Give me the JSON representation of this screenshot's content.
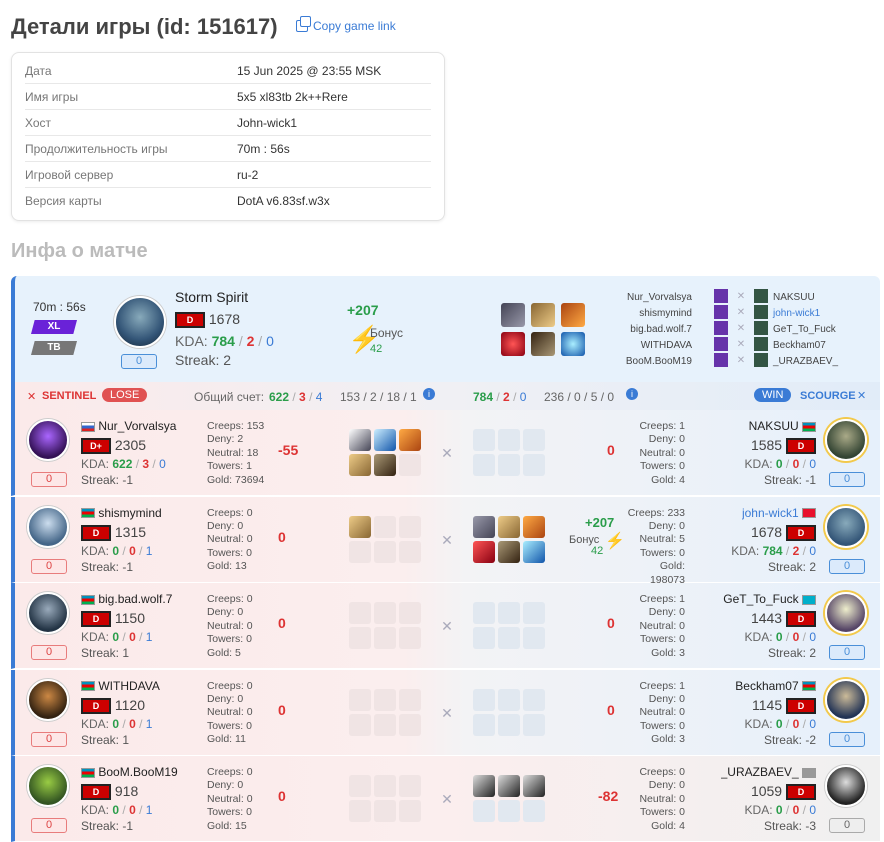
{
  "page": {
    "title": "Детали игры (id: 151617)",
    "copy_link": "Copy game link",
    "section2": "Инфа о матче"
  },
  "info": [
    {
      "k": "Дата",
      "v": "15 Jun 2025 @ 23:55 MSK"
    },
    {
      "k": "Имя игры",
      "v": "5x5 xl83tb 2k++Rere"
    },
    {
      "k": "Хост",
      "v": "John-wick1"
    },
    {
      "k": "Продолжительность игры",
      "v": "70m : 56s"
    },
    {
      "k": "Игровой сервер",
      "v": "ru-2"
    },
    {
      "k": "Версия карты",
      "v": "DotA v6.83sf.w3x"
    }
  ],
  "summary": {
    "duration": "70m : 56s",
    "tag1": "XL",
    "tag2": "TB",
    "hero": "Storm Spirit",
    "badge": "D",
    "rating": "1678",
    "kda_label": "KDA:",
    "k": "784",
    "d": "2",
    "a": "0",
    "streak": "Streak: 2",
    "count": "0",
    "delta": "+207",
    "bonus_label": "Бонус",
    "bonus": "42",
    "left_players": [
      "Nur_Vorvalsya",
      "shismymind",
      "big.bad.wolf.7",
      "WITHDAVA",
      "BooM.BooM19"
    ],
    "right_players": [
      "NAKSUU",
      "john-wick1",
      "GeT_To_Fuck",
      "Beckham07",
      "_URAZBAEV_"
    ]
  },
  "teams": {
    "sentinel": "SENTINEL",
    "lose": "LOSE",
    "total_label": "Общий счет:",
    "s_k": "622",
    "s_d": "3",
    "s_a": "4",
    "s_creeps": "153 / 2 / 18 / 1",
    "sc_k": "784",
    "sc_d": "2",
    "sc_a": "0",
    "sc_creeps": "236 / 0 / 5 / 0",
    "win": "WIN",
    "scourge": "SCOURGE"
  },
  "rows": [
    {
      "lname": "Nur_Vorvalsya",
      "lbadge": "D+",
      "lrating": "2305",
      "lk": "622",
      "ld": "3",
      "la": "0",
      "lstreak": "Streak: -1",
      "lcnt": "0",
      "lcreeps": "153",
      "ldeny": "2",
      "lneutral": "18",
      "ltowers": "1",
      "lgold": "73694",
      "ldiff": "-55",
      "rname": "NAKSUU",
      "rrating": "1585",
      "rk": "0",
      "rd": "0",
      "ra": "0",
      "rstreak": "Streak: -1",
      "rcnt": "0",
      "rcreeps": "1",
      "rdeny": "0",
      "rneutral": "0",
      "rtowers": "0",
      "rgold": "4",
      "rdiff": "0"
    },
    {
      "lname": "shismymind",
      "lbadge": "D",
      "lrating": "1315",
      "lk": "0",
      "ld": "0",
      "la": "1",
      "lstreak": "Streak: -1",
      "lcnt": "0",
      "lcreeps": "0",
      "ldeny": "0",
      "lneutral": "0",
      "ltowers": "0",
      "lgold": "13",
      "ldiff": "0",
      "rname": "john-wick1",
      "rrating": "1678",
      "rk": "784",
      "rd": "2",
      "ra": "0",
      "rstreak": "Streak: 2",
      "rcnt": "0",
      "rcreeps": "233",
      "rdeny": "0",
      "rneutral": "5",
      "rtowers": "0",
      "rgold": "198073",
      "rdiff": "+207",
      "rbonus_label": "Бонус",
      "rbonus": "42"
    },
    {
      "lname": "big.bad.wolf.7",
      "lbadge": "D",
      "lrating": "1150",
      "lk": "0",
      "ld": "0",
      "la": "1",
      "lstreak": "Streak: 1",
      "lcnt": "0",
      "lcreeps": "0",
      "ldeny": "0",
      "lneutral": "0",
      "ltowers": "0",
      "lgold": "5",
      "ldiff": "0",
      "rname": "GeT_To_Fuck",
      "rrating": "1443",
      "rk": "0",
      "rd": "0",
      "ra": "0",
      "rstreak": "Streak: 2",
      "rcnt": "0",
      "rcreeps": "1",
      "rdeny": "0",
      "rneutral": "0",
      "rtowers": "0",
      "rgold": "3",
      "rdiff": "0"
    },
    {
      "lname": "WITHDAVA",
      "lbadge": "D",
      "lrating": "1120",
      "lk": "0",
      "ld": "0",
      "la": "1",
      "lstreak": "Streak: 1",
      "lcnt": "0",
      "lcreeps": "0",
      "ldeny": "0",
      "lneutral": "0",
      "ltowers": "0",
      "lgold": "11",
      "ldiff": "0",
      "rname": "Beckham07",
      "rrating": "1145",
      "rk": "0",
      "rd": "0",
      "ra": "0",
      "rstreak": "Streak: -2",
      "rcnt": "0",
      "rcreeps": "1",
      "rdeny": "0",
      "rneutral": "0",
      "rtowers": "0",
      "rgold": "3",
      "rdiff": "0"
    },
    {
      "lname": "BooM.BooM19",
      "lbadge": "D",
      "lrating": "918",
      "lk": "0",
      "ld": "0",
      "la": "1",
      "lstreak": "Streak: -1",
      "lcnt": "0",
      "lcreeps": "0",
      "ldeny": "0",
      "lneutral": "0",
      "ltowers": "0",
      "lgold": "15",
      "ldiff": "0",
      "rname": "_URAZBAEV_",
      "rrating": "1059",
      "rk": "0",
      "rd": "0",
      "ra": "0",
      "rstreak": "Streak: -3",
      "rcnt": "0",
      "rcreeps": "0",
      "rdeny": "0",
      "rneutral": "0",
      "rtowers": "0",
      "rgold": "4",
      "rdiff": "-82"
    }
  ],
  "labels": {
    "creeps": "Creeps:",
    "deny": "Deny:",
    "neutral": "Neutral:",
    "towers": "Towers:",
    "gold": "Gold:",
    "kda": "KDA:"
  },
  "colors": {
    "accent": "#3a7bd5",
    "win": "#2a9d4a",
    "lose": "#d33"
  }
}
